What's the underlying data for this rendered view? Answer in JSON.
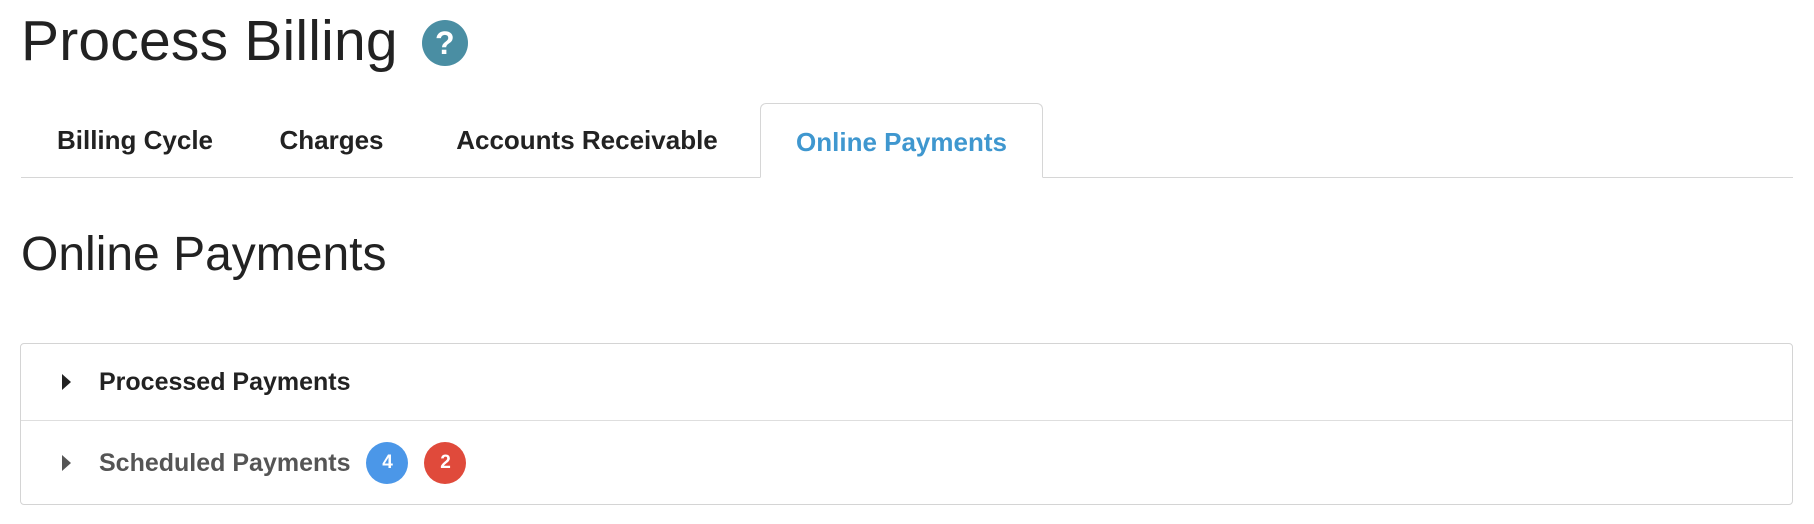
{
  "header": {
    "title": "Process Billing",
    "help_icon": "question-circle-icon",
    "help_glyph": "?"
  },
  "tabs": [
    {
      "label": "Billing Cycle",
      "active": false
    },
    {
      "label": "Charges",
      "active": false
    },
    {
      "label": "Accounts Receivable",
      "active": false
    },
    {
      "label": "Online Payments",
      "active": true
    }
  ],
  "section": {
    "heading": "Online Payments"
  },
  "accordion": {
    "items": [
      {
        "label": "Processed Payments",
        "icon": "caret-right-icon",
        "badges": []
      },
      {
        "label": "Scheduled Payments",
        "icon": "caret-right-icon",
        "badges": [
          {
            "value": "4",
            "color": "#4b97e8"
          },
          {
            "value": "2",
            "color": "#e04a3b"
          }
        ]
      }
    ]
  },
  "colors": {
    "accent": "#3f97cf",
    "help_icon_bg": "#4a8ea3",
    "badge_blue": "#4b97e8",
    "badge_red": "#e04a3b"
  }
}
